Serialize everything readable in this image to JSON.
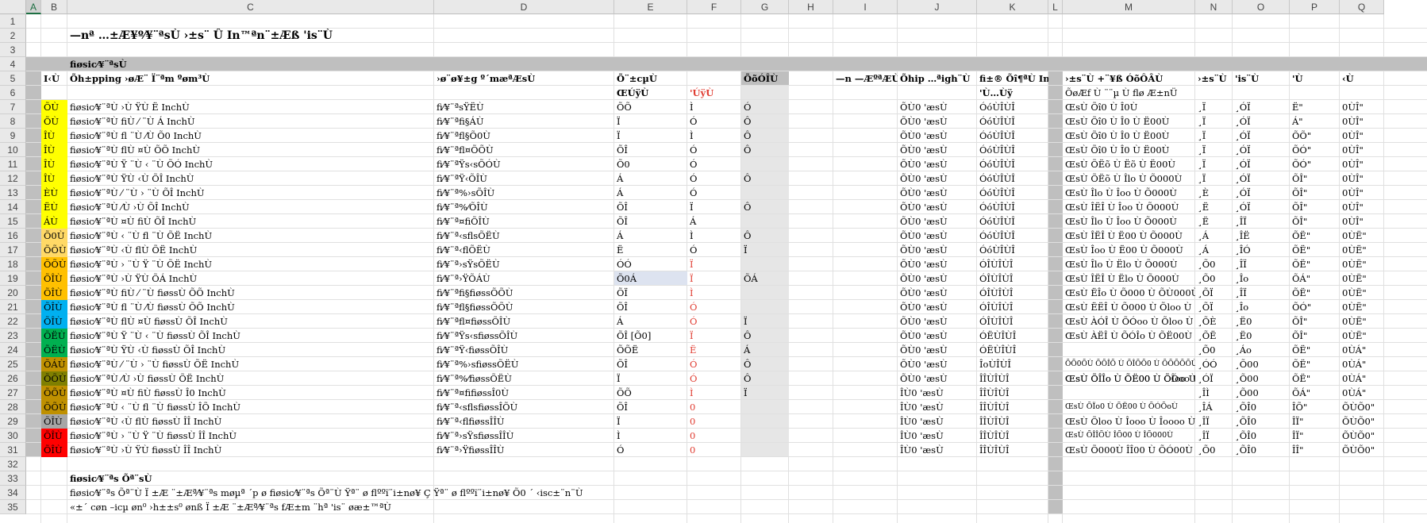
{
  "columns": [
    "A",
    "B",
    "C",
    "D",
    "E",
    "F",
    "G",
    "H",
    "I",
    "J",
    "K",
    "L",
    "M",
    "N",
    "O",
    "P",
    "Q"
  ],
  "rows": [
    "1",
    "2",
    "3",
    "4",
    "5",
    "6",
    "7",
    "8",
    "9",
    "10",
    "11",
    "12",
    "13",
    "14",
    "15",
    "16",
    "17",
    "18",
    "19",
    "20",
    "21",
    "22",
    "23",
    "24",
    "25",
    "26",
    "27",
    "28",
    "29",
    "30",
    "31",
    "32",
    "33",
    "34",
    "35"
  ],
  "title": "—nª …±Æ¥º⁄¥¨ªsÙ ›±s¨ Û In™ªn¨±Æß 'is¨Ù",
  "section_header": "fiøsic⁄¥¨ªsÙ",
  "headers": {
    "b": "I‹Ù",
    "c": "Õh±pping ›øÆ¨ Ï¨ªm ºøm³Ù",
    "d": "›ø¨ø¥±g º´mæªÆsÙ",
    "e": "Õ¨±cµÙ",
    "g": "ÕõÓÎÙ",
    "i": "—n —ÆºªÆÙ",
    "j": "Õhip …ªigh¨Ù",
    "k": "fi±® Õî¶ªÙ InchÙ",
    "m": "›±s¨Ù +¨¥ß ÓõÔÂÙ",
    "n": "›±s¨Ù",
    "o": "'is¨Ù",
    "p": "'Ù",
    "q": "‹Ù"
  },
  "subheaders": {
    "e": "ŒÚÿÙ",
    "f": "'ÚÿÙ",
    "k": "'Ù…Ùÿ",
    "m": "ÕøÆf Ù ¨¨µ Ù flø Æ±nÜ"
  },
  "table_rows": [
    {
      "b": "ÕÙ",
      "c": "fiøsic⁄¥¨ªÙ ›Ù ŸÙ Ë InchÙ",
      "d": "fi⁄¥¨ªsŸËÙ",
      "e": "ÕÕ",
      "f": "Ì",
      "g": "Ó",
      "j": "ÕÙ0 'æsÙ",
      "k": "ÓóÙÎÙÎ",
      "m": "ŒsÙ Õî0 Ù Î0Ù",
      "n": "¸Ï",
      "o": "¸ÓÏ",
      "p": "Ë\"",
      "q": "0ÙÎ\""
    },
    {
      "b": "ÕÙ",
      "c": "fiøsic⁄¥¨ªÙ fiÙ ⁄ ¨Ù Á InchÙ",
      "d": "fi⁄¥¨ªfi§ÁÙ",
      "e": "Ï",
      "f": "Ó",
      "g": "Ô",
      "j": "ÕÙ0 'æsÙ",
      "k": "ÓóÙÎÙÎ",
      "m": "ŒsÙ Õî0 Ù Î0 Ù Ë00Ù",
      "n": "¸Ï",
      "o": "¸ÓÏ",
      "p": "Á\"",
      "q": "0ÙÎ\""
    },
    {
      "b": "ÎÙ",
      "c": "fiøsic⁄¥¨ªÙ fl ¨Ù ⁄Ù Õ0 InchÙ",
      "d": "fi⁄¥¨ªfl§Õ0Ù",
      "e": "Ï",
      "f": "Ì",
      "g": "Ô",
      "j": "ÕÙ0 'æsÙ",
      "k": "ÓóÙÎÙÎ",
      "m": "ŒsÙ Õî0 Ù Î0 Ù Ë00Ù",
      "n": "¸Ï",
      "o": "¸ÓÏ",
      "p": "ÕÕ\"",
      "q": "0ÙÎ\""
    },
    {
      "b": "ÎÙ",
      "c": "fiøsic⁄¥¨ªÙ flÙ ¤Ù ÕÕ InchÙ",
      "d": "fi⁄¥¨ªfl¤ÕÕÙ",
      "e": "ÕÎ",
      "f": "Ó",
      "g": "Ô",
      "j": "ÕÙ0 'æsÙ",
      "k": "ÓóÙÎÙÎ",
      "m": "ŒsÙ Õî0 Ù Î0 Ù Ë00Ù",
      "n": "¸Ï",
      "o": "¸ÓÏ",
      "p": "ÕÓ\"",
      "q": "0ÙÎ\""
    },
    {
      "b": "ÎÙ",
      "c": "fiøsic⁄¥¨ªÙ Ÿ ¨Ù ‹ ¨Ù ÕÓ InchÙ",
      "d": "fi⁄¥¨ªŸs‹sÕÓÙ",
      "e": "Õ0",
      "f": "Ó",
      "g": "",
      "j": "ÕÙ0 'æsÙ",
      "k": "ÓóÙÎÙÎ",
      "m": "ŒsÙ ÕËõ Ù Ëõ Ù Ë00Ù",
      "n": "¸Ï",
      "o": "¸ÓÏ",
      "p": "ÕÓ\"",
      "q": "0ÙÎ\""
    },
    {
      "b": "ÎÙ",
      "c": "fiøsic⁄¥¨ªÙ ŸÙ ‹Ù ÕÎ InchÙ",
      "d": "fi⁄¥¨ªŸ‹ÕÎÙ",
      "e": "Á",
      "f": "Ó",
      "g": "Ô",
      "j": "ÕÙ0 'æsÙ",
      "k": "ÓóÙÎÙÎ",
      "m": "ŒsÙ ÕËõ Ù Îlo Ù Õ000Ù",
      "n": "¸Ï",
      "o": "¸ÓÏ",
      "p": "ÕÎ\"",
      "q": "0ÙÎ\""
    },
    {
      "b": "ÈÙ",
      "c": "fiøsic⁄¥¨ªÙ ⁄ ¨Ù › ¨Ù ÕÎ InchÙ",
      "d": "fi⁄¥¨ª%›sÕÎÙ",
      "e": "Á",
      "f": "Ó",
      "g": "",
      "j": "ÕÙ0 'æsÙ",
      "k": "ÓóÙÎÙÎ",
      "m": "ŒsÙ Îlo Ù Îoo Ù Õ000Ù",
      "n": "¸È",
      "o": "¸ÓÏ",
      "p": "ÕÎ\"",
      "q": "0ÙÎ\""
    },
    {
      "b": "ËÙ",
      "c": "fiøsic⁄¥¨ªÙ ⁄Ù ›Ù ÕÎ InchÙ",
      "d": "fi⁄¥¨ª%⁄ÕÎÙ",
      "e": "ÕÎ",
      "f": "Ï",
      "g": "Ô",
      "j": "ÕÙ0 'æsÙ",
      "k": "ÓóÙÎÙÎ",
      "m": "ŒsÙ ÎËÎ Ù Îoo Ù Õ000Ù",
      "n": "¸Ë",
      "o": "¸ÓÏ",
      "p": "ÕÎ\"",
      "q": "0ÙÎ\""
    },
    {
      "b": "ÁÙ",
      "c": "fiøsic⁄¥¨ªÙ ¤Ù fiÙ ÕÎ InchÙ",
      "d": "fi⁄¥¨ª¤fiÕÎÙ",
      "e": "ÕÎ",
      "f": "Á",
      "g": "",
      "j": "ÕÙ0 'æsÙ",
      "k": "ÓóÙÎÙÎ",
      "m": "ŒsÙ Îlo Ù Îoo Ù Õ000Ù",
      "n": "¸Ë",
      "o": "¸ÎÏ",
      "p": "ÕÎ\"",
      "q": "0ÙÎ\""
    },
    {
      "b": "Õ0Ù",
      "c": "fiøsic⁄¥¨ªÙ ‹ ¨Ù fl ¨Ù ÕË InchÙ",
      "d": "fi⁄¥¨ª‹sflsÕËÙ",
      "e": "Á",
      "f": "Ì",
      "g": "Ô",
      "j": "ÕÙ0 'æsÙ",
      "k": "ÓóÙÎÙÎ",
      "m": "ŒsÙ ÎËÎ Ù Ë00 Ù Õ000Ù",
      "n": "¸Á",
      "o": "¸ÎË",
      "p": "ÕË\"",
      "q": "0ÙË\""
    },
    {
      "b": "ÕÕÙ",
      "c": "fiøsic⁄¥¨ªÙ ‹Ù flÙ ÕË InchÙ",
      "d": "fi⁄¥¨ª‹flÕËÙ",
      "e": "Ë",
      "f": "Ó",
      "g": "Ï",
      "j": "ÕÙ0 'æsÙ",
      "k": "ÓóÙÎÙÎ",
      "m": "ŒsÙ Îoo Ù Ë00 Ù Õ000Ù",
      "n": "¸Á",
      "o": "¸ÎÓ",
      "p": "ÕË\"",
      "q": "0ÙË\""
    },
    {
      "b": "ÕÕÙ",
      "c": "fiøsic⁄¥¨ªÙ › ¨Ù Ÿ ¨Ù ÕË InchÙ",
      "d": "fi⁄¥¨ª›sŸsÕËÙ",
      "e": "ÓÓ",
      "f": "Ï",
      "g": "",
      "j": "ÕÙ0 'æsÙ",
      "k": "ÓÎÙÎÙÎ",
      "m": "ŒsÙ Îlo Ù Ëlo Ù Õ000Ù",
      "n": "¸Õ0",
      "o": "¸ÎÏ",
      "p": "ÕË\"",
      "q": "0ÙË\""
    },
    {
      "b": "ÕÎÙ",
      "c": "fiøsic⁄¥¨ªÙ ›Ù ŸÙ ÕÁ InchÙ",
      "d": "fi⁄¥¨ª›ŸÕÁÙ",
      "e": "Õ0Á",
      "f": "Ï",
      "g": "ÕÁ",
      "j": "ÕÙ0 'æsÙ",
      "k": "ÓÎÙÎÙÎ",
      "m": "ŒsÙ ÎËÎ Ù Ëlo Ù Õ000Ù",
      "n": "¸Õ0",
      "o": "¸Îo",
      "p": "ÕÁ\"",
      "q": "0ÙË\""
    },
    {
      "b": "ÕÎÙ",
      "c": "fiøsic⁄¥¨ªÙ fiÙ ⁄ ¨Ù fiøssÙ ÕÕ InchÙ",
      "d": "fi⁄¥¨ªfi§fiøssÕÕÙ",
      "e": "ÕÏ",
      "f": "Ì",
      "g": "",
      "j": "ÕÙ0 'æsÙ",
      "k": "ÓÎÙÎÙÎ",
      "m": "ŒsÙ ËÎo Ù Õ000 Ù ÕÙ000Ù",
      "n": "¸ÕÏ",
      "o": "¸ÎÏ",
      "p": "ÕË\"",
      "q": "0ÙË\""
    },
    {
      "b": "ÕÎÙ",
      "c": "fiøsic⁄¥¨ªÙ fl ¨Ù ⁄Ù fiøssÙ ÕÕ InchÙ",
      "d": "fi⁄¥¨ªfl§fiøssÕÕÙ",
      "e": "ÕÎ",
      "f": "Ó",
      "g": "",
      "j": "ÕÙ0 'æsÙ",
      "k": "ÓÎÙÎÙÎ",
      "m": "ŒsÙ ËËÎ Ù Õ000 Ù Õloo Ù",
      "n": "¸ÕÏ",
      "o": "¸Îo",
      "p": "ÕÓ\"",
      "q": "0ÙË\""
    },
    {
      "b": "ÕÎÙ",
      "c": "fiøsic⁄¥¨ªÙ flÙ ¤Ù fiøssÙ ÕÎ InchÙ",
      "d": "fi⁄¥¨ªfl¤fiøssÕÎÙ",
      "e": "Á",
      "f": "Ó",
      "g": "Ï",
      "j": "ÕÙ0 'æsÙ",
      "k": "ÓÎÙÎÙÎ",
      "m": "ŒsÙ ÀÓÎ Ù ÕÓoo Ù Õloo Ù",
      "n": "¸ÕÈ",
      "o": "¸Ë0",
      "p": "ÕÎ\"",
      "q": "0ÙË\""
    },
    {
      "b": "ÕËÙ",
      "c": "fiøsic⁄¥¨ªÙ Ÿ ¨Ù ‹ ¨Ù fiøssÙ ÕÎ InchÙ",
      "d": "fi⁄¥¨ªŸs‹sfiøssÕÎÙ",
      "e": "ÕÎ [Õ0]",
      "f": "Ï",
      "g": "Ô",
      "j": "ÕÙ0 'æsÙ",
      "k": "ÓËÙÎÙÎ",
      "m": "ŒsÙ ÀËÎ Ù ÕÓÎo Ù ÕË00Ù",
      "n": "¸ÕË",
      "o": "¸Ë0",
      "p": "ÕÎ\"",
      "q": "0ÙË\""
    },
    {
      "b": "ÕËÙ",
      "c": "fiøsic⁄¥¨ªÙ ŸÙ ‹Ù fiøssÙ ÕÎ InchÙ",
      "d": "fi⁄¥¨ªŸ‹fiøssÕÎÙ",
      "e": "ÕÕË",
      "f": "Ë",
      "g": "Á",
      "j": "ÕÙ0 'æsÙ",
      "k": "ÓËÙÎÙÎ",
      "m": "",
      "n": "¸Õ0",
      "o": "¸Áo",
      "p": "ÕË\"",
      "q": "0ÙÁ\""
    },
    {
      "b": "ÕÁÙ",
      "c": "fiøsic⁄¥¨ªÙ ⁄ ¨Ù › ¨Ù fiøssÙ ÕË InchÙ",
      "d": "fi⁄¥¨ª%›sfiøssÕËÙ",
      "e": "ÕÎ",
      "f": "Ó",
      "g": "Ô",
      "j": "ÕÙ0 'æsÙ",
      "k": "ÎoÙÎÙÎ",
      "m": "",
      "n": "¸ÓÓ",
      "o": "¸Õ00",
      "p": "ÕË\"",
      "q": "0ÙÁ\""
    },
    {
      "b": "ÕÕÙ",
      "c": "fiøsic⁄¥¨ªÙ ⁄Ù ›Ù fiøssÙ ÕË InchÙ",
      "d": "fi⁄¥¨ª%⁄fiøssÕËÙ",
      "e": "Ï",
      "f": "Ó",
      "g": "Ô",
      "j": "ÕÙ0 'æsÙ",
      "k": "ÎÎÙÎÙÎ",
      "m": "ŒsÙ ÕÎÎo Ù ÕË00 Ù ÕÎoo Ù",
      "n": "¸ÓÏ",
      "o": "¸Õ00",
      "p": "ÕË\"",
      "q": "0ÙÁ\""
    },
    {
      "b": "ÕÕÙ",
      "c": "fiøsic⁄¥¨ªÙ ¤Ù fiÙ fiøssÙ Î0 InchÙ",
      "d": "fi⁄¥¨ª¤fifiøssÎ0Ù",
      "e": "ÕÕ",
      "f": "Ì",
      "g": "Ï",
      "j": "ÎÙ0 'æsÙ",
      "k": "ÎÎÙÎÙÎ",
      "m": "",
      "n": "¸ÎÌ",
      "o": "¸Õ00",
      "p": "ÕÁ\"",
      "q": "0ÙÁ\""
    },
    {
      "b": "ÕÕÙ",
      "c": "fiøsic⁄¥¨ªÙ ‹ ¨Ù fl ¨Ù fiøssÙ ÎÕ InchÙ",
      "d": "fi⁄¥¨ª‹sflsfiøssÎÕÙ",
      "e": "ÕÎ",
      "f": "0",
      "g": "",
      "j": "ÎÙ0 'æsÙ",
      "k": "ÎÎÙÎÙÎ",
      "m": "",
      "n": "¸ÎÁ",
      "o": "¸ÕÎ0",
      "p": "ÎÕ\"",
      "q": "ÕÙÕ0\""
    },
    {
      "b": "ÕÎÙ",
      "c": "fiøsic⁄¥¨ªÙ ‹Ù flÙ fiøssÙ ÎÎ InchÙ",
      "d": "fi⁄¥¨ª‹flfiøssÎÎÙ",
      "e": "Ï",
      "f": "0",
      "g": "",
      "j": "ÎÙ0 'æsÙ",
      "k": "ÎÎÙÎÙÎ",
      "m": "",
      "n": "¸ÎÏ",
      "o": "¸ÕÎ0",
      "p": "ÎÏ\"",
      "q": "ÕÙÕ0\""
    },
    {
      "b": "ÕÎÙ",
      "c": "fiøsic⁄¥¨ªÙ › ¨Ù Ÿ ¨Ù fiøssÙ ÎÎ InchÙ",
      "d": "fi⁄¥¨ª›sŸsfiøssÎÎÙ",
      "e": "Ì",
      "f": "0",
      "g": "",
      "j": "ÎÙ0 'æsÙ",
      "k": "ÎÎÙÎÙÎ",
      "m": "",
      "n": "¸ÎÏ",
      "o": "¸ÕÎ0",
      "p": "ÎÏ\"",
      "q": "ÕÙÕ0\""
    },
    {
      "b": "ÕÎÙ",
      "c": "fiøsic⁄¥¨ªÙ ›Ù ŸÙ fiøssÙ ÎÎ InchÙ",
      "d": "fi⁄¥¨ª›ŸfiøssÎÎÙ",
      "e": "Ó",
      "f": "0",
      "g": "",
      "j": "ÎÙ0 'æsÙ",
      "k": "ÎÎÙÎÙÎ",
      "m": "ŒsÙ Õ000Ù ÎÎ00 Ù ÕÓ00Ù",
      "n": "¸Õ0",
      "o": "¸ÕÎ0",
      "p": "ÎÎ\"",
      "q": "ÕÙÕ0\""
    }
  ],
  "special_rows": {
    "r19_m": "",
    "r25_m": "ÕÕ0ÕÙ ÕÕÎÕ Ù ÕÎÕÕ0 Ù ÕÕÕÕÕÙ",
    "r26_m": "ŒsÙ ÕÎÎo Ù ÕË00 Ù ÕÓoo Ù",
    "r28_m": "ŒsÙ ÕÏo0 Ù ÕË00 Ù ÕÓÕoÙ",
    "r29_m": "ŒsÙ Õloo Ù Îooo Ù Îoooo Ù",
    "r30_m": "ŒsÙ ÕÎÎÕÙ ÎÕ00 Ù ÎÕ000Ù"
  },
  "b_colors": [
    "#ffff00",
    "#ffff00",
    "#ffff00",
    "#ffff00",
    "#ffff00",
    "#ffff00",
    "#ffff00",
    "#ffff00",
    "#ffff00",
    "#ffd966",
    "#ffd966",
    "#ffc000",
    "#ffc000",
    "#ffc000",
    "#00b0f0",
    "#00b0f0",
    "#00b050",
    "#00b050",
    "#bf9000",
    "#7f7f00",
    "#bf9000",
    "#bf9000",
    "#a6a6a6",
    "#ff0000",
    "#ff0000"
  ],
  "footer_header": "fiøsic⁄¥¨ªs Õª¨sÙ",
  "footer_line1": "fiøsic⁄¥¨ªs Õª¨Ù Ï ±Æ ¨±Æª⁄¥¨ªs møµª ´p ø fiøsic⁄¥¨ªs Õª¨Ù  Ÿª¨ ø flººï¨i±nø¥ Ç Ÿª¨ ø flººï¨i±nø¥ Õ0 ´ ‹isc±¨n¨Ù",
  "footer_line2": "«±´ cøn –icµ øn⁰ ›h±±s⁰ ønß Ï ±Æ ¨±Æª⁄¥¨ªs fÆ±m ¨hª 'is¨ øæ±™ªÙ",
  "highlight_e19": "ÕöÁÙ"
}
